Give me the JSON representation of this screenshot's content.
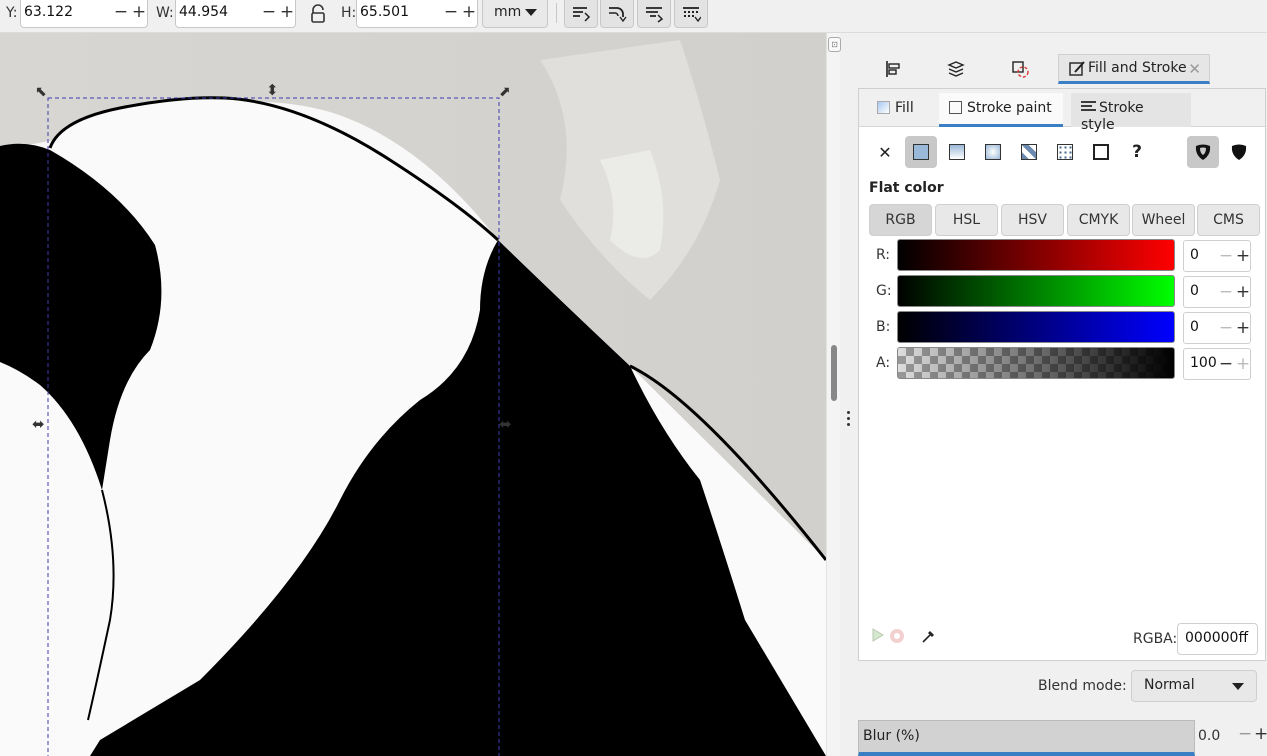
{
  "toolbar": {
    "y_label": "Y:",
    "y_value": "63.122",
    "w_label": "W:",
    "w_value": "44.954",
    "h_label": "H:",
    "h_value": "65.501",
    "unit": "mm",
    "minus": "−",
    "plus": "+"
  },
  "panel": {
    "dock_tabs": [
      "align-distribute-icon",
      "layers-icon",
      "transform-icon",
      "fill-stroke-icon"
    ],
    "active_tab_label": "Fill and Stroke",
    "mode_tabs": [
      "Fill",
      "Stroke paint",
      "Stroke style"
    ],
    "active_mode": "Stroke paint",
    "paint_types": [
      "No paint",
      "Flat color",
      "Linear gradient",
      "Radial gradient",
      "Mesh gradient",
      "Pattern",
      "Swatch",
      "Unset"
    ],
    "flat_color_label": "Flat color",
    "color_modes": [
      "RGB",
      "HSL",
      "HSV",
      "CMYK",
      "Wheel",
      "CMS"
    ],
    "active_color_mode": "RGB",
    "channels": [
      {
        "label": "R:",
        "value": "0"
      },
      {
        "label": "G:",
        "value": "0"
      },
      {
        "label": "B:",
        "value": "0"
      },
      {
        "label": "A:",
        "value": "100"
      }
    ],
    "rgba_label": "RGBA:",
    "rgba_value": "000000ff",
    "blend_label": "Blend mode:",
    "blend_value": "Normal",
    "blur_label": "Blur (%)",
    "blur_value": "0.0",
    "accent_color": "#3a7fc4"
  }
}
